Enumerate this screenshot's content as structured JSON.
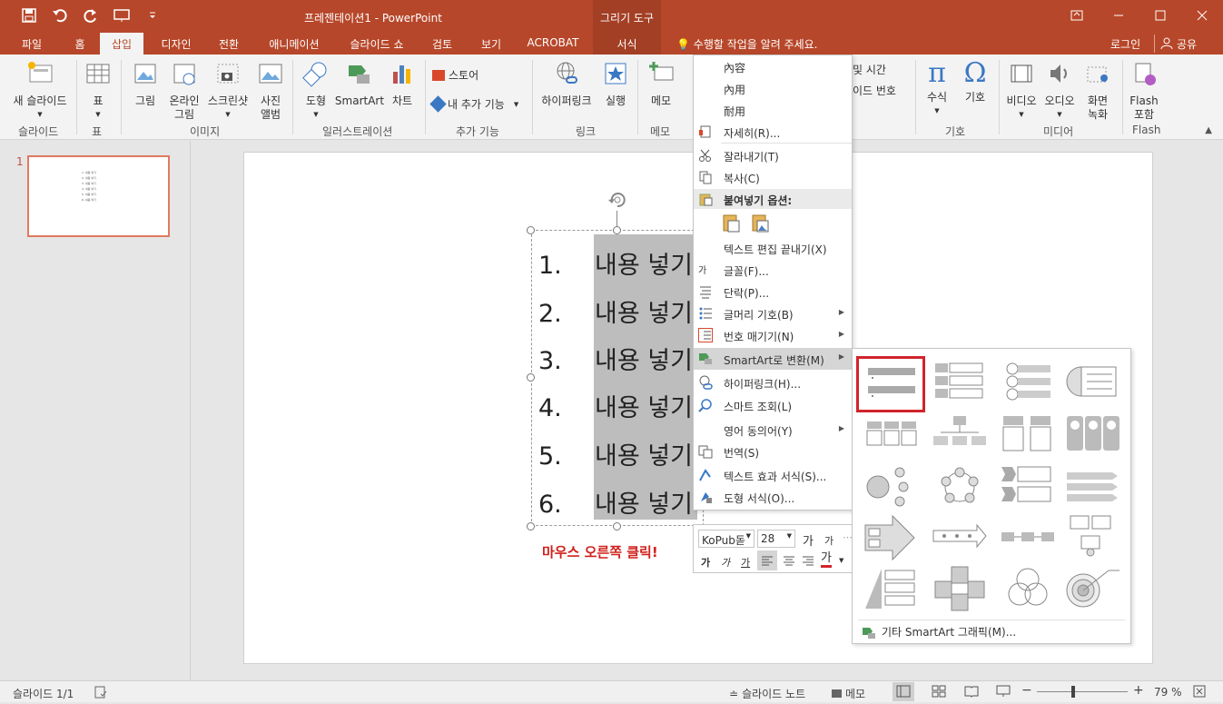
{
  "titlebar": {
    "title": "프레젠테이션1 - PowerPoint",
    "contextual_group": "그리기 도구"
  },
  "tabs": [
    "파일",
    "홈",
    "삽입",
    "디자인",
    "전환",
    "애니메이션",
    "슬라이드 쇼",
    "검토",
    "보기",
    "ACROBAT",
    "서식"
  ],
  "active_tab": "삽입",
  "tell_me": "수행할 작업을 알려 주세요.",
  "login": "로그인",
  "share": "공유",
  "ribbon": {
    "buttons": {
      "new_slide": "새 슬라이드",
      "table": "표",
      "picture": "그림",
      "online_pic_1": "온라인",
      "online_pic_2": "그림",
      "screenshot": "스크린샷",
      "album_1": "사진",
      "album_2": "앨범",
      "shapes": "도형",
      "smartart": "SmartArt",
      "chart": "차트",
      "store": "스토어",
      "my_addins": "내 추가 기능",
      "hyperlink": "하이퍼링크",
      "action": "실행",
      "comment": "메모",
      "datetime": "및 시간",
      "slidenum": "이드 번호",
      "equation": "수식",
      "symbol": "기호",
      "video": "비디오",
      "audio": "오디오",
      "screen_rec_1": "화면",
      "screen_rec_2": "녹화",
      "flash_1": "Flash",
      "flash_2": "포함"
    },
    "groups": {
      "slides": "슬라이드",
      "tables": "표",
      "images": "이미지",
      "illustrations": "일러스트레이션",
      "addins": "추가 기능",
      "links": "링크",
      "comments": "메모",
      "symbols": "기호",
      "media": "미디어",
      "flash": "Flash"
    }
  },
  "thumbnail": {
    "number": "1",
    "lines": [
      "1. 내용 넣기",
      "2. 내용 넣기",
      "3. 내용 넣기",
      "4. 내용 넣기",
      "5. 내용 넣기",
      "6. 내용 넣기"
    ]
  },
  "slide": {
    "list": [
      {
        "num": "1.",
        "text": "내용 넣기"
      },
      {
        "num": "2.",
        "text": "내용 넣기"
      },
      {
        "num": "3.",
        "text": "내용 넣기"
      },
      {
        "num": "4.",
        "text": "내용 넣기"
      },
      {
        "num": "5.",
        "text": "내용 넣기"
      },
      {
        "num": "6.",
        "text": "내용 넣기"
      }
    ],
    "note": "마우스 오른쪽 클릭!"
  },
  "context_menu": {
    "ime_1": "內容",
    "ime_2": "內用",
    "ime_3": "耐用",
    "detail": "자세히(R)...",
    "cut": "잘라내기(T)",
    "copy": "복사(C)",
    "paste_options": "붙여넣기 옵션:",
    "exit_edit": "텍스트 편집 끝내기(X)",
    "font": "글꼴(F)...",
    "paragraph": "단락(P)...",
    "bullets": "글머리 기호(B)",
    "numbering": "번호 매기기(N)",
    "smartart": "SmartArt로 변환(M)",
    "hyperlink": "하이퍼링크(H)...",
    "smart_lookup": "스마트 조회(L)",
    "synonyms": "영어 동의어(Y)",
    "translate": "번역(S)",
    "text_effects": "텍스트 효과 서식(S)...",
    "shape_format": "도형 서식(O)..."
  },
  "mini_toolbar": {
    "font": "KoPub돋",
    "size": "28"
  },
  "gallery": {
    "more": "기타 SmartArt 그래픽(M)..."
  },
  "statusbar": {
    "slide_pos": "슬라이드 1/1",
    "notes": "슬라이드 노트",
    "comments": "메모",
    "zoom": "79 %"
  },
  "colors": {
    "accent": "#b7472a",
    "highlight_box": "#d1242b",
    "note_text": "#d0211c"
  }
}
